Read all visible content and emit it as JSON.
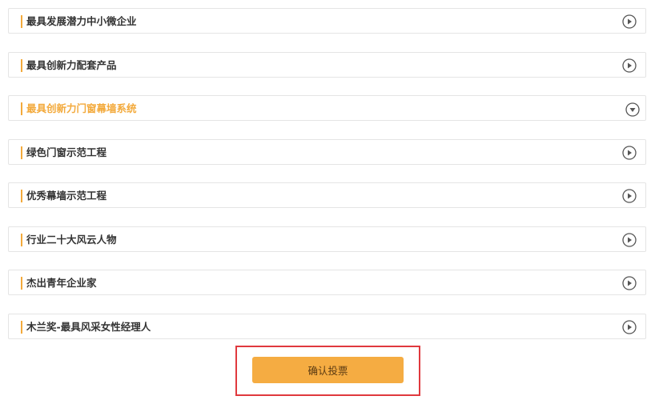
{
  "categories": [
    {
      "label": "最具发展潜力中小微企业",
      "state": "collapsed"
    },
    {
      "label": "最具创新力配套产品",
      "state": "collapsed"
    },
    {
      "label": "最具创新力门窗幕墙系统",
      "state": "expanded"
    },
    {
      "label": "绿色门窗示范工程",
      "state": "collapsed"
    },
    {
      "label": "优秀幕墙示范工程",
      "state": "collapsed"
    },
    {
      "label": "行业二十大风云人物",
      "state": "collapsed"
    },
    {
      "label": "杰出青年企业家",
      "state": "collapsed"
    },
    {
      "label": "木兰奖-最具风采女性经理人",
      "state": "collapsed"
    }
  ],
  "vote": {
    "button_label": "确认投票"
  },
  "colors": {
    "accent": "#f3aa3c",
    "button": "#f5ac42",
    "highlight_border": "#e0393e",
    "row_border": "#e4e4e4",
    "text": "#333333"
  },
  "icons": {
    "collapsed": "play-circle-icon",
    "expanded": "chevron-down-circle-icon"
  }
}
